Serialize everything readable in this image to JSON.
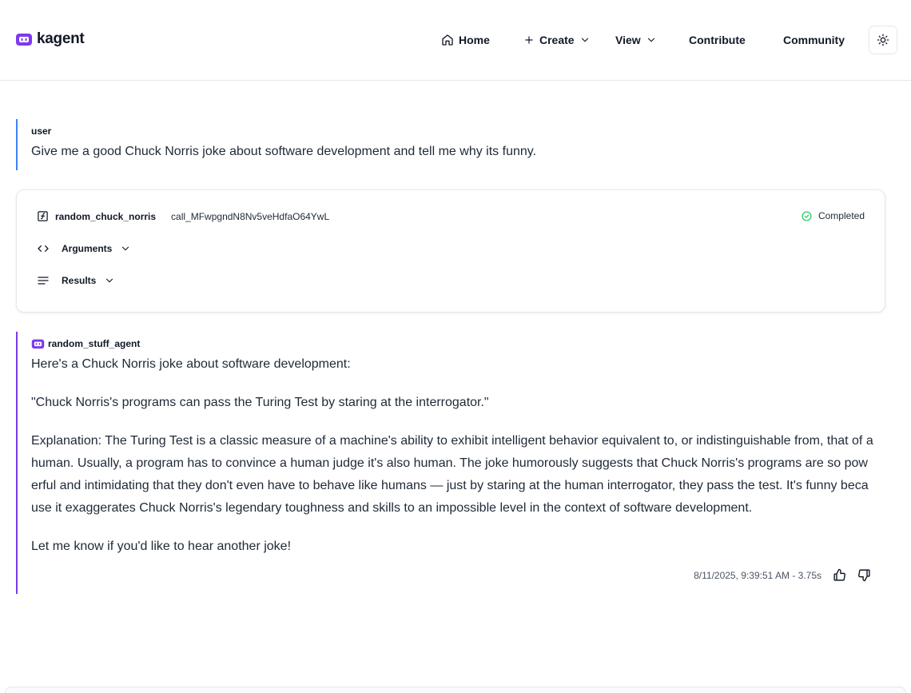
{
  "app": {
    "name": "kagent",
    "brand_color": "#7c3aed"
  },
  "nav": {
    "home": "Home",
    "create": "Create",
    "view": "View",
    "contribute": "Contribute",
    "community": "Community"
  },
  "user_message": {
    "role": "user",
    "text": "Give me a good Chuck Norris joke about software development and tell me why its funny."
  },
  "tool_call": {
    "name": "random_chuck_norris",
    "call_id": "call_MFwpgndN8Nv5veHdfaO64YwL",
    "status": "Completed",
    "status_color": "#22c55e",
    "arguments_label": "Arguments",
    "results_label": "Results"
  },
  "agent_message": {
    "agent_name": "random_stuff_agent",
    "paragraphs": [
      "Here's a Chuck Norris joke about software development:",
      "\"Chuck Norris's programs can pass the Turing Test by staring at the interrogator.\"",
      "Explanation: The Turing Test is a classic measure of a machine's ability to exhibit intelligent behavior equivalent to, or indistinguishable from, that of a human. Usually, a program has to convince a human judge it's also human. The joke humorously suggests that Chuck Norris's programs are so powerful and intimidating that they don't even have to behave like humans — just by staring at the human interrogator, they pass the test. It's funny because it exaggerates Chuck Norris's legendary toughness and skills to an impossible level in the context of software development.",
      "Let me know if you'd like to hear another joke!"
    ],
    "timestamp": "8/11/2025, 9:39:51 AM - 3.75s"
  }
}
